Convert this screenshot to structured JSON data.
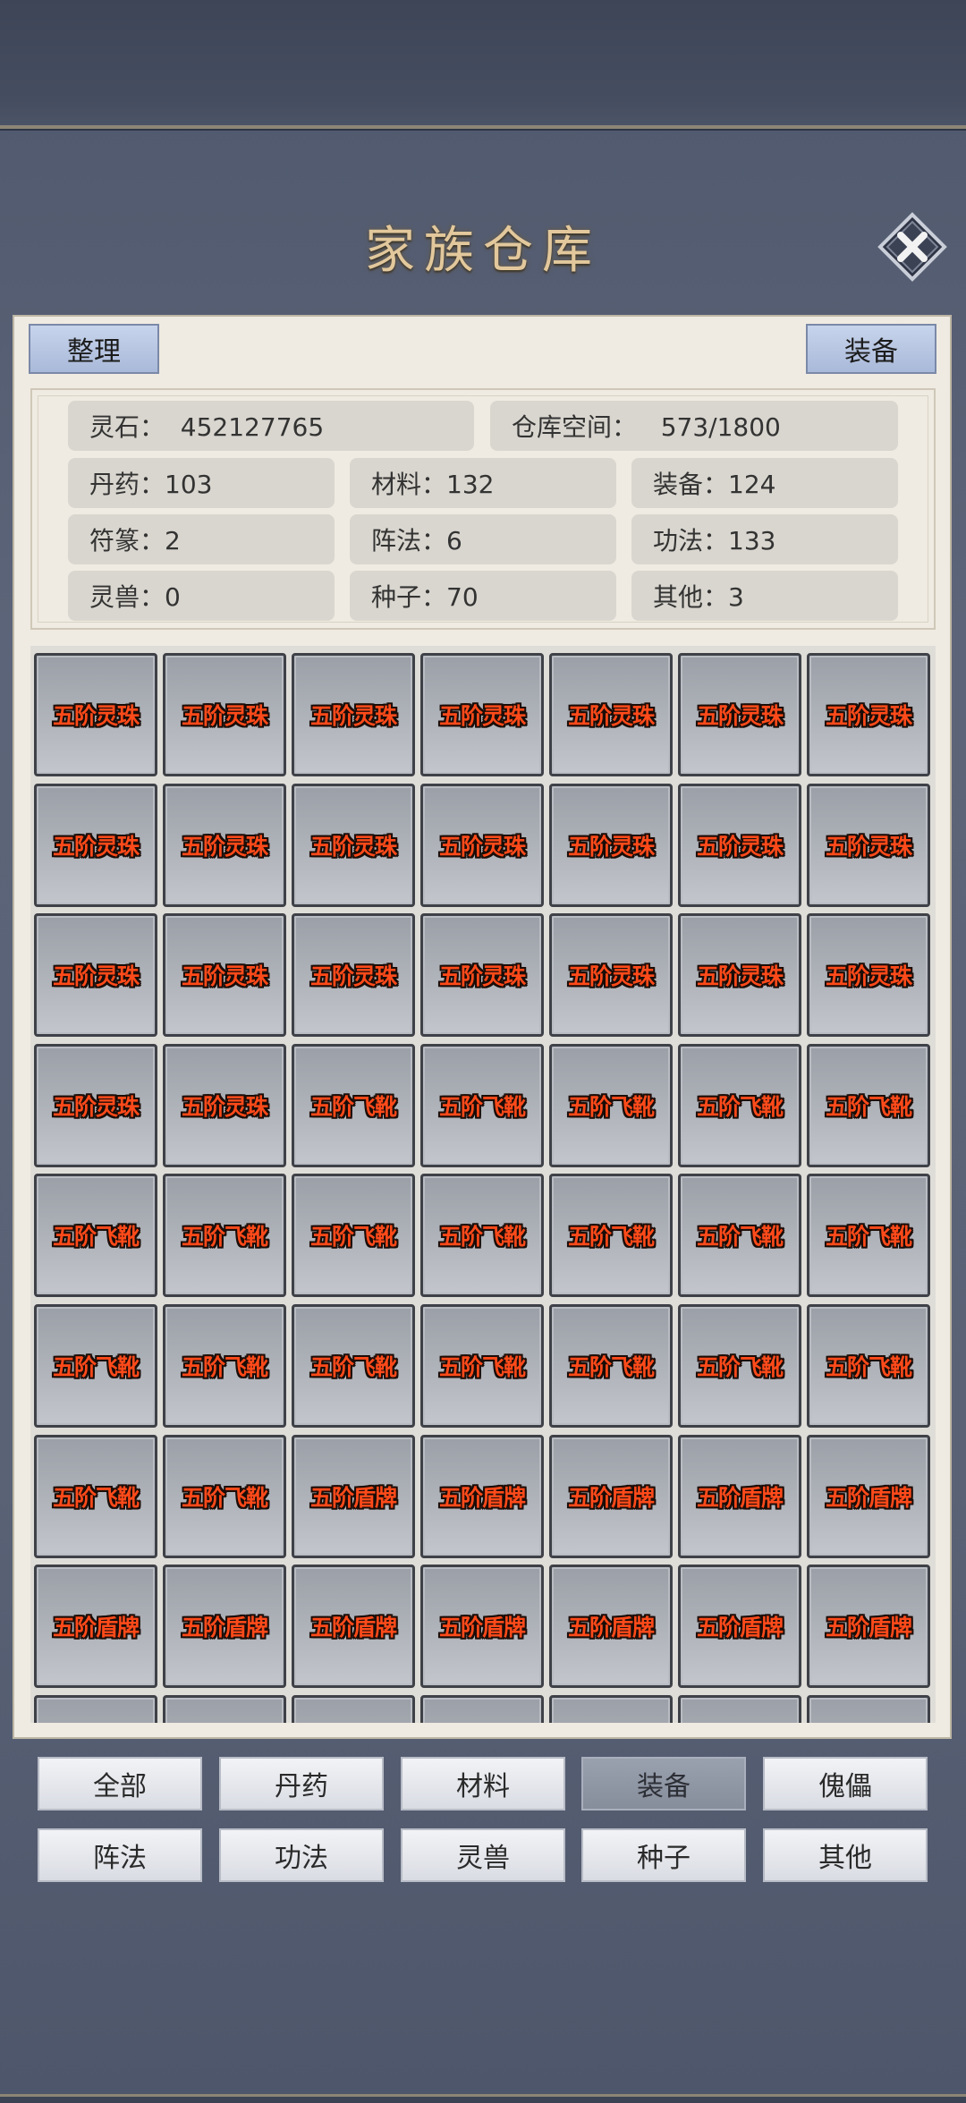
{
  "title": "家族仓库",
  "toolbar": {
    "sort_label": "整理",
    "equip_label": "装备"
  },
  "stats": {
    "spirit_stone": "灵石：  452127765",
    "storage": "仓库空间：   573/1800",
    "pills": "丹药：103",
    "materials": "材料：132",
    "equipment": "装备：124",
    "talismans": "符篆：2",
    "formations": "阵法：6",
    "techniques": "功法：133",
    "beasts": "灵兽：0",
    "seeds": "种子：70",
    "others": "其他：3"
  },
  "items": [
    "五阶灵珠",
    "五阶灵珠",
    "五阶灵珠",
    "五阶灵珠",
    "五阶灵珠",
    "五阶灵珠",
    "五阶灵珠",
    "五阶灵珠",
    "五阶灵珠",
    "五阶灵珠",
    "五阶灵珠",
    "五阶灵珠",
    "五阶灵珠",
    "五阶灵珠",
    "五阶灵珠",
    "五阶灵珠",
    "五阶灵珠",
    "五阶灵珠",
    "五阶灵珠",
    "五阶灵珠",
    "五阶灵珠",
    "五阶灵珠",
    "五阶灵珠",
    "五阶飞靴",
    "五阶飞靴",
    "五阶飞靴",
    "五阶飞靴",
    "五阶飞靴",
    "五阶飞靴",
    "五阶飞靴",
    "五阶飞靴",
    "五阶飞靴",
    "五阶飞靴",
    "五阶飞靴",
    "五阶飞靴",
    "五阶飞靴",
    "五阶飞靴",
    "五阶飞靴",
    "五阶飞靴",
    "五阶飞靴",
    "五阶飞靴",
    "五阶飞靴",
    "五阶飞靴",
    "五阶飞靴",
    "五阶盾牌",
    "五阶盾牌",
    "五阶盾牌",
    "五阶盾牌",
    "五阶盾牌",
    "五阶盾牌",
    "五阶盾牌",
    "五阶盾牌",
    "五阶盾牌",
    "五阶盾牌",
    "五阶盾牌",
    "五阶盾牌",
    "",
    "",
    "",
    "",
    "",
    "",
    ""
  ],
  "tabs": [
    {
      "label": "全部",
      "active": false
    },
    {
      "label": "丹药",
      "active": false
    },
    {
      "label": "材料",
      "active": false
    },
    {
      "label": "装备",
      "active": true
    },
    {
      "label": "傀儡",
      "active": false
    },
    {
      "label": "阵法",
      "active": false
    },
    {
      "label": "功法",
      "active": false
    },
    {
      "label": "灵兽",
      "active": false
    },
    {
      "label": "种子",
      "active": false
    },
    {
      "label": "其他",
      "active": false
    }
  ],
  "colors": {
    "item_text": "#ff4a1a",
    "title": "#e2c89c",
    "panel": "#efebe2"
  },
  "icons": {
    "close": "close-x-icon"
  }
}
